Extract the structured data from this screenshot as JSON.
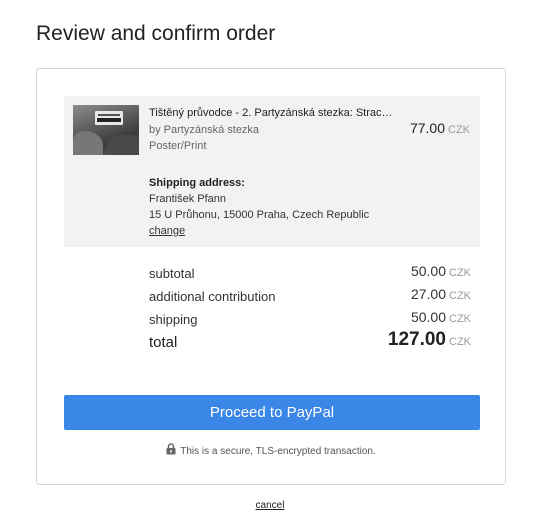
{
  "page": {
    "title": "Review and confirm order"
  },
  "item": {
    "title": "Tištěný průvodce - 2. Partyzánská stezka: Strac…",
    "author": "by Partyzánská stezka",
    "format": "Poster/Print",
    "price": "77.00",
    "currency": "CZK",
    "thumbnail": "guide-cover-image"
  },
  "shipping": {
    "label": "Shipping address:",
    "name": "František Pfann",
    "address": "15 U Průhonu, 15000 Praha, Czech Republic",
    "change_label": "change"
  },
  "summary": {
    "rows": [
      {
        "label": "subtotal",
        "amount": "50.00",
        "currency": "CZK"
      },
      {
        "label": "additional contribution",
        "amount": "27.00",
        "currency": "CZK"
      },
      {
        "label": "shipping",
        "amount": "50.00",
        "currency": "CZK"
      }
    ],
    "total": {
      "label": "total",
      "amount": "127.00",
      "currency": "CZK"
    }
  },
  "payment": {
    "button_label": "Proceed to PayPal",
    "button_color": "#3b87e8",
    "secure_text": "This is a secure, TLS-encrypted transaction.",
    "secure_icon": "lock-icon"
  },
  "footer": {
    "cancel_label": "cancel"
  }
}
